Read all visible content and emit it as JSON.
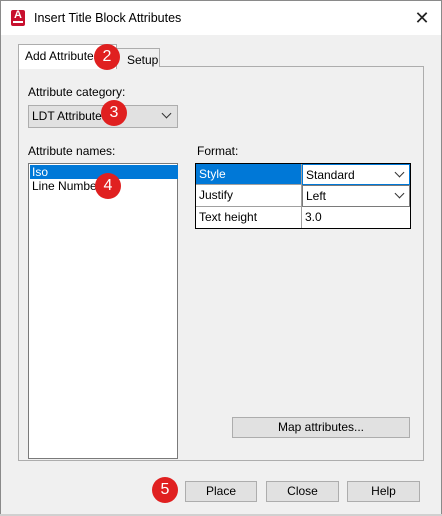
{
  "window": {
    "title": "Insert Title Block Attributes",
    "close_glyph": "✕"
  },
  "tabs": [
    {
      "label": "Add Attributes"
    },
    {
      "label": "Setup"
    }
  ],
  "category": {
    "label": "Attribute category:",
    "value": "LDT Attributes"
  },
  "attribute_names": {
    "label": "Attribute names:",
    "items": [
      "Iso",
      "Line Number"
    ]
  },
  "format": {
    "label": "Format:",
    "rows": [
      {
        "name": "Style",
        "value": "Standard"
      },
      {
        "name": "Justify",
        "value": "Left"
      },
      {
        "name": "Text height",
        "value": "3.0"
      }
    ]
  },
  "buttons": {
    "map": "Map attributes...",
    "place": "Place",
    "close": "Close",
    "help": "Help"
  },
  "badges": [
    "2",
    "3",
    "4",
    "5"
  ],
  "colors": {
    "selection": "#0078d7",
    "badge": "#e02020",
    "app_icon": "#c8102e"
  }
}
